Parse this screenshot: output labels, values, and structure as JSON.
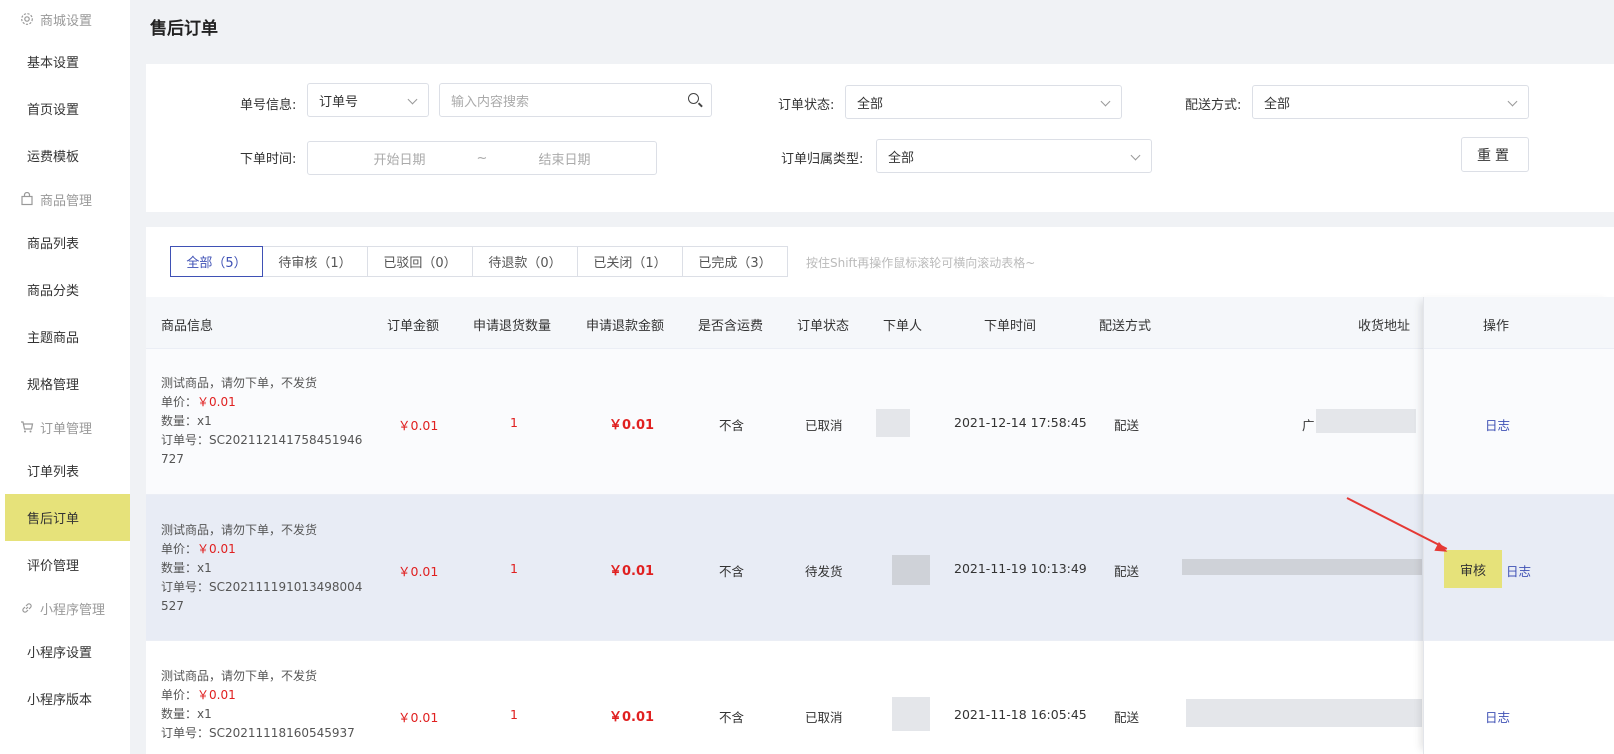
{
  "sidebar": {
    "group_shop": "商城设置",
    "basic": "基本设置",
    "home": "首页设置",
    "freight": "运费模板",
    "group_goods": "商品管理",
    "goods_list": "商品列表",
    "goods_cat": "商品分类",
    "theme_goods": "主题商品",
    "spec": "规格管理",
    "group_order": "订单管理",
    "order_list": "订单列表",
    "aftersale": "售后订单",
    "review": "评价管理",
    "group_mini": "小程序管理",
    "mini_settings": "小程序设置",
    "mini_version": "小程序版本"
  },
  "page_title": "售后订单",
  "filters": {
    "order_no_label": "单号信息:",
    "order_no_type": "订单号",
    "search_placeholder": "输入内容搜索",
    "status_label": "订单状态:",
    "status_value": "全部",
    "delivery_label": "配送方式:",
    "delivery_value": "全部",
    "time_label": "下单时间:",
    "start_date": "开始日期",
    "tilde": "~",
    "end_date": "结束日期",
    "belong_label": "订单归属类型:",
    "belong_value": "全部",
    "reset": "重置"
  },
  "tabs": [
    {
      "label": "全部（5）"
    },
    {
      "label": "待审核（1）"
    },
    {
      "label": "已驳回（0）"
    },
    {
      "label": "待退款（0）"
    },
    {
      "label": "已关闭（1）"
    },
    {
      "label": "已完成（3）"
    }
  ],
  "tab_hint": "按住Shift再操作鼠标滚轮可横向滚动表格~",
  "columns": {
    "info": "商品信息",
    "amount": "订单金额",
    "qty": "申请退货数量",
    "refund": "申请退款金额",
    "freight": "是否含运费",
    "status": "订单状态",
    "buyer": "下单人",
    "time": "下单时间",
    "delivery": "配送方式",
    "address": "收货地址",
    "op": "操作"
  },
  "rows": [
    {
      "name": "测试商品，请勿下单，不发货",
      "price_label": "单价：",
      "price": "￥0.01",
      "qty_label": "数量：x1",
      "order_no": "订单号：SC202112141758451946",
      "order_no2": "727",
      "amount": "￥0.01",
      "qty": "1",
      "refund": "￥0.01",
      "freight": "不含",
      "status": "已取消",
      "time": "2021-12-14 17:58:45",
      "delivery": "配送",
      "addr_frag": "广",
      "log": "日志"
    },
    {
      "name": "测试商品，请勿下单，不发货",
      "price_label": "单价：",
      "price": "￥0.01",
      "qty_label": "数量：x1",
      "order_no": "订单号：SC202111191013498004",
      "order_no2": "527",
      "amount": "￥0.01",
      "qty": "1",
      "refund": "￥0.01",
      "freight": "不含",
      "status": "待发货",
      "time": "2021-11-19 10:13:49",
      "delivery": "配送",
      "audit": "审核",
      "log": "日志"
    },
    {
      "name": "测试商品，请勿下单，不发货",
      "price_label": "单价：",
      "price": "￥0.01",
      "qty_label": "数量：x1",
      "order_no": "订单号：SC20211118160545937",
      "amount": "￥0.01",
      "qty": "1",
      "refund": "￥0.01",
      "freight": "不含",
      "status": "已取消",
      "time": "2021-11-18 16:05:45",
      "delivery": "配送",
      "log": "日志"
    }
  ],
  "colors": {
    "accent": "#3f51b5",
    "highlight": "#e6e27a",
    "price": "#e02020"
  }
}
